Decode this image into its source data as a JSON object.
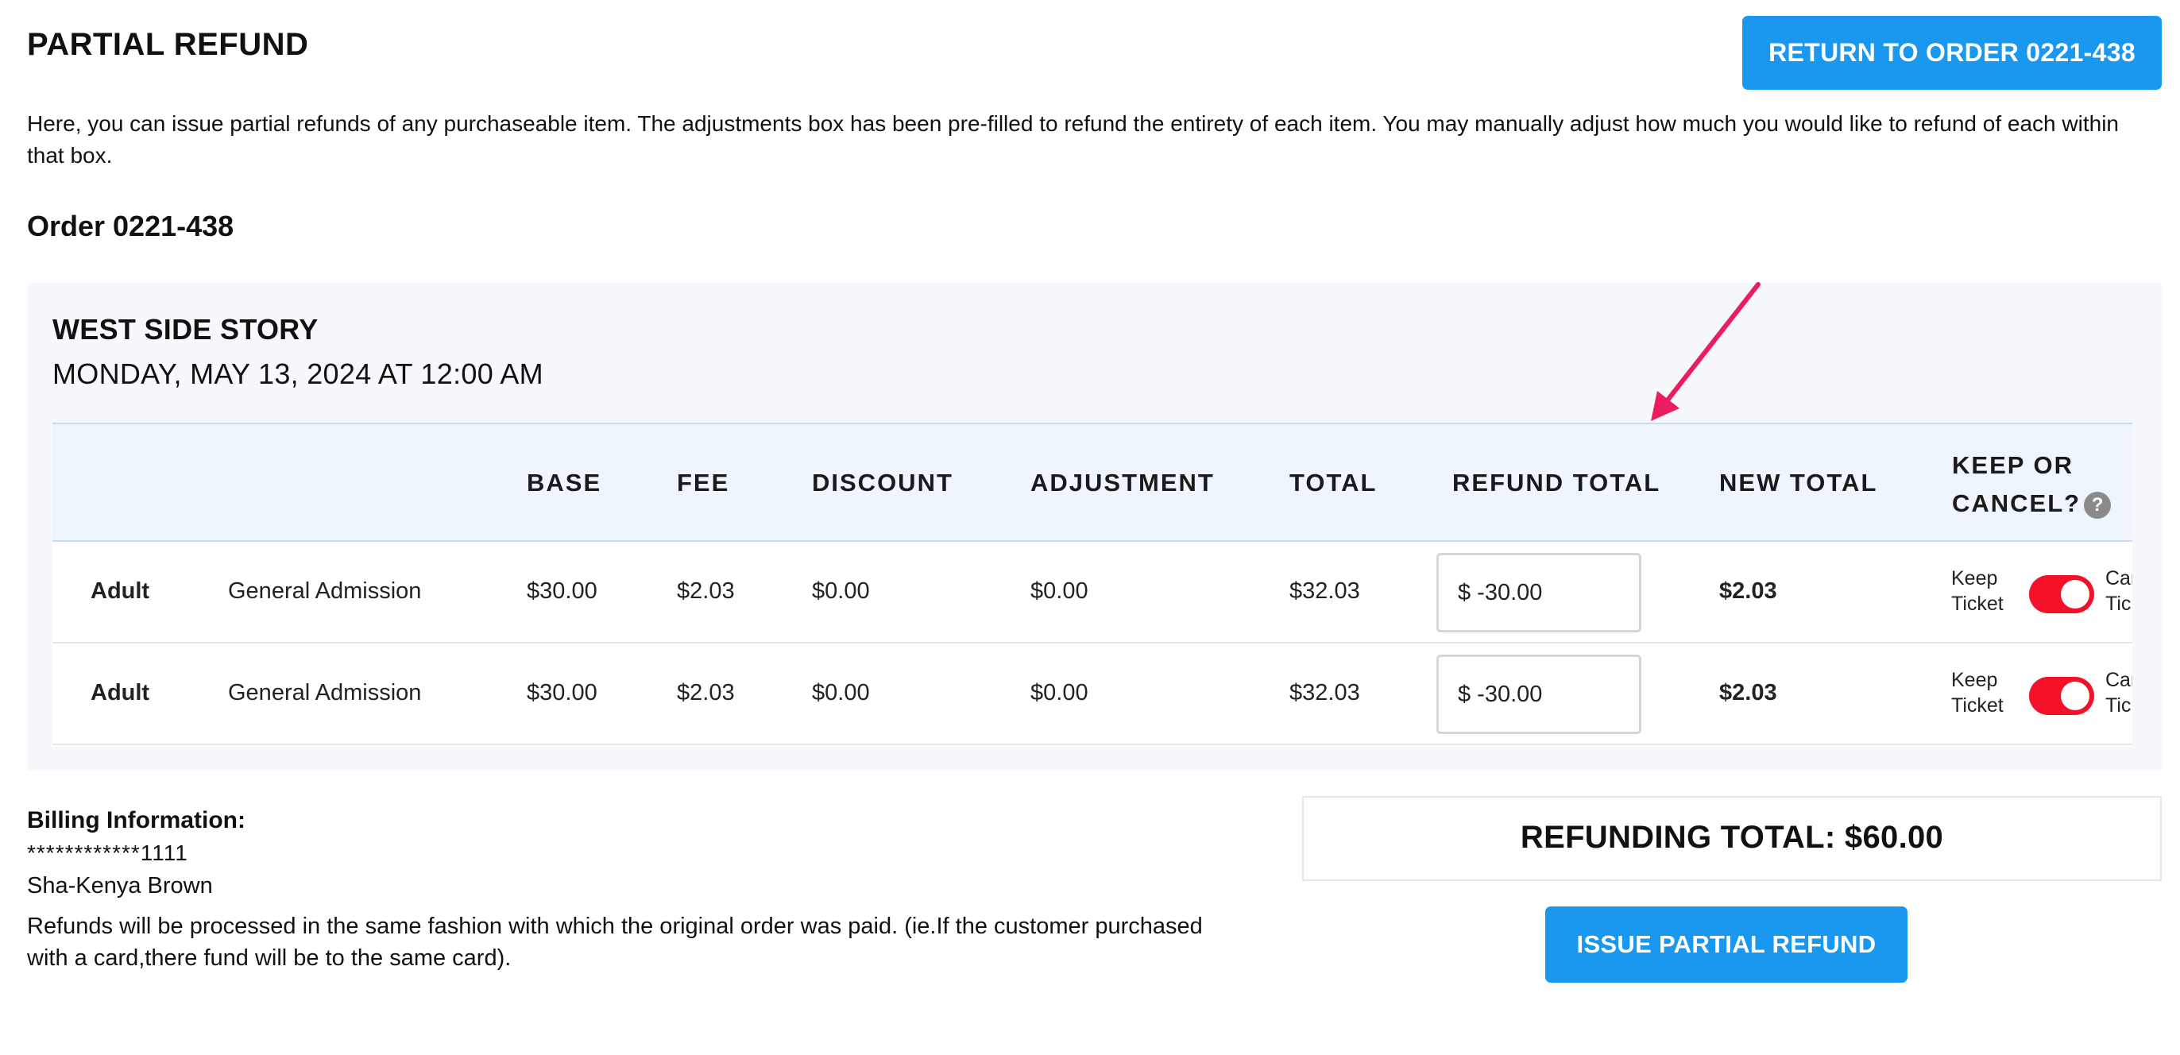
{
  "header": {
    "title": "PARTIAL REFUND",
    "return_button": "RETURN TO ORDER 0221-438"
  },
  "intro": "Here, you can issue partial refunds of any purchaseable item. The adjustments box has been pre-filled to refund the entirety of each item. You may manually adjust how much you would like to refund of each within that box.",
  "order": {
    "title": "Order 0221-438"
  },
  "event": {
    "name": "WEST SIDE STORY",
    "date": "MONDAY, MAY 13, 2024 AT 12:00 AM"
  },
  "table": {
    "headers": {
      "base": "BASE",
      "fee": "FEE",
      "discount": "DISCOUNT",
      "adjustment": "ADJUSTMENT",
      "total": "TOTAL",
      "refund_total": "REFUND TOTAL",
      "new_total": "NEW TOTAL",
      "keep_or_cancel_line1": "KEEP OR",
      "keep_or_cancel_line2": "CANCEL?"
    },
    "help_icon": "?",
    "rows": [
      {
        "type": "Adult",
        "section": "General Admission",
        "base": "$30.00",
        "fee": "$2.03",
        "discount": "$0.00",
        "adjustment": "$0.00",
        "total": "$32.03",
        "refund_value": "$ -30.00",
        "new_total": "$2.03",
        "keep_line1": "Keep",
        "keep_line2": "Ticket",
        "cancel_line1": "Cancel",
        "cancel_line2": "Ticket",
        "toggle_on": true
      },
      {
        "type": "Adult",
        "section": "General Admission",
        "base": "$30.00",
        "fee": "$2.03",
        "discount": "$0.00",
        "adjustment": "$0.00",
        "total": "$32.03",
        "refund_value": "$ -30.00",
        "new_total": "$2.03",
        "keep_line1": "Keep",
        "keep_line2": "Ticket",
        "cancel_line1": "Cancel",
        "cancel_line2": "Ticket",
        "toggle_on": true
      }
    ]
  },
  "billing": {
    "title": "Billing Information:",
    "card": "************1111",
    "name": "Sha-Kenya Brown",
    "note": "Refunds will be processed in the same fashion with which the original order was paid. (ie.If the customer purchased with a card,there fund will be to the same card)."
  },
  "summary": {
    "refunding_total": "REFUNDING TOTAL: $60.00",
    "issue_button": "ISSUE PARTIAL REFUND"
  },
  "colors": {
    "primary_button": "#1a97ee",
    "toggle_on": "#f5102a",
    "annotation_arrow": "#ec1d5e",
    "table_header_bg": "#eef5fd",
    "card_bg": "#f6f8fb"
  },
  "icons": {
    "help": "question-circle-icon",
    "annotation": "arrow-annotation-icon"
  }
}
